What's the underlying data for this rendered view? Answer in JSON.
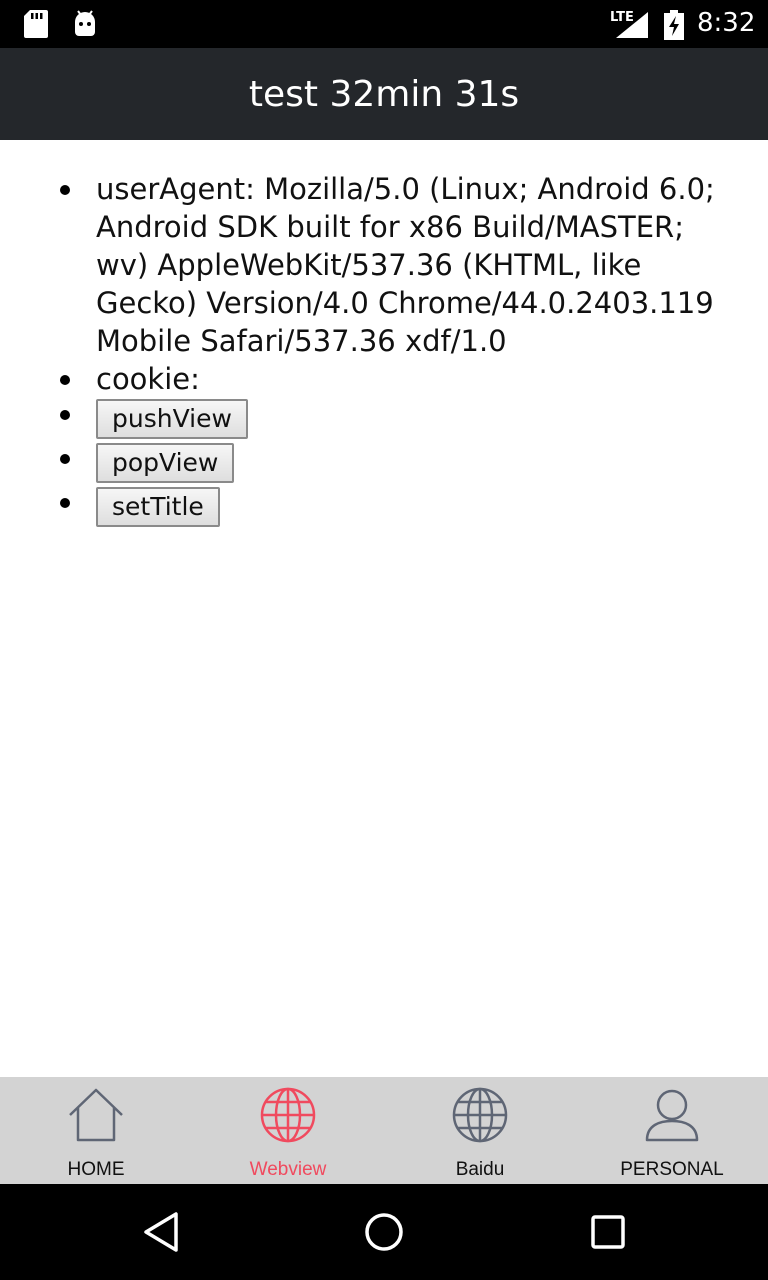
{
  "status_bar": {
    "network": "LTE",
    "time": "8:32"
  },
  "title_bar": {
    "title": "test 32min 31s"
  },
  "content": {
    "list": [
      {
        "type": "text",
        "text": "userAgent: Mozilla/5.0 (Linux; Android 6.0; Android SDK built for x86 Build/MASTER; wv) AppleWebKit/537.36 (KHTML, like Gecko) Version/4.0 Chrome/44.0.2403.119 Mobile Safari/537.36 xdf/1.0"
      },
      {
        "type": "text",
        "text": "cookie:"
      },
      {
        "type": "button",
        "label": "pushView"
      },
      {
        "type": "button",
        "label": "popView"
      },
      {
        "type": "button",
        "label": "setTitle"
      }
    ]
  },
  "tab_bar": {
    "active_color": "#f04a5e",
    "inactive_color": "#5f6675",
    "tabs": [
      {
        "label": "HOME",
        "icon": "home-icon",
        "active": false
      },
      {
        "label": "Webview",
        "icon": "globe-icon",
        "active": true
      },
      {
        "label": "Baidu",
        "icon": "globe-icon",
        "active": false
      },
      {
        "label": "PERSONAL",
        "icon": "person-icon",
        "active": false
      }
    ]
  },
  "nav_bar": {
    "buttons": [
      "back-icon",
      "home-circle-icon",
      "recents-icon"
    ]
  }
}
